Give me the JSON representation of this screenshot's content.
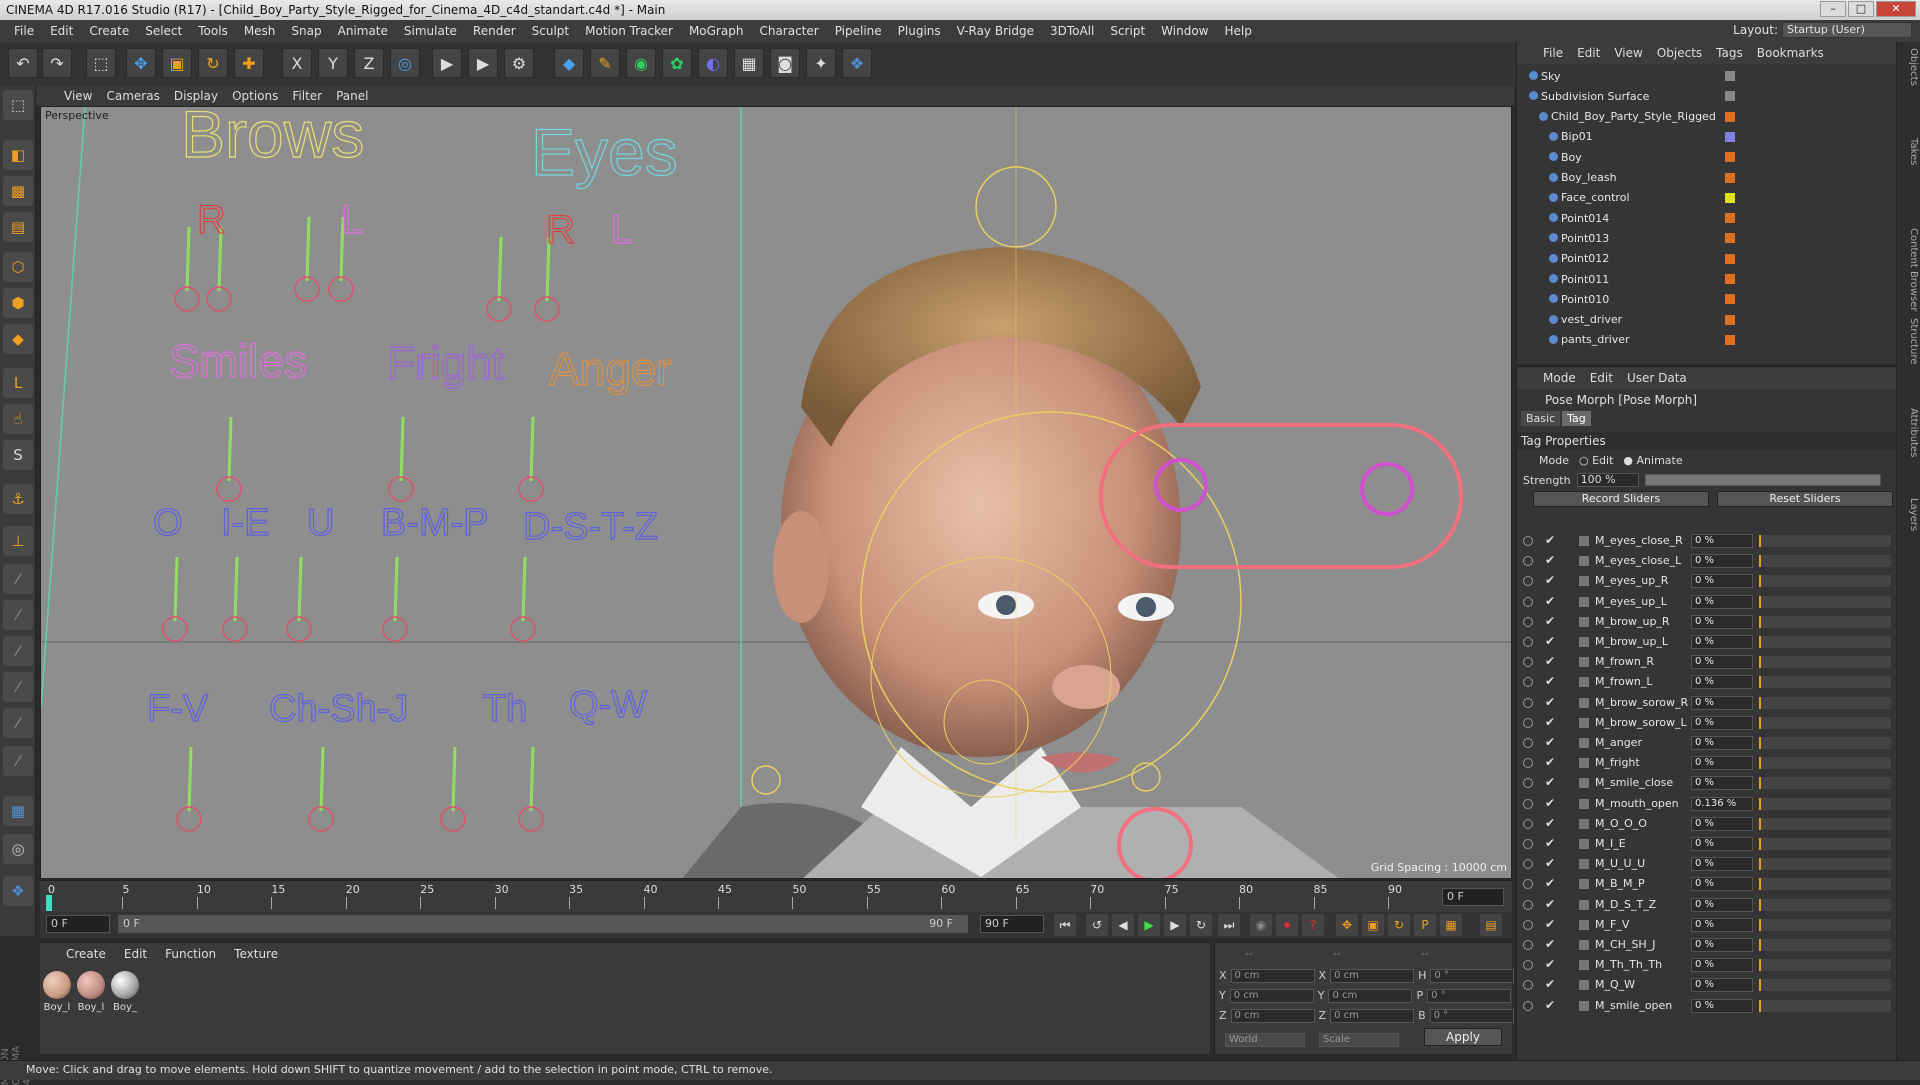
{
  "window": {
    "title": "CINEMA 4D R17.016 Studio (R17) - [Child_Boy_Party_Style_Rigged_for_Cinema_4D_c4d_standart.c4d *] - Main"
  },
  "menubar": [
    "File",
    "Edit",
    "Create",
    "Select",
    "Tools",
    "Mesh",
    "Snap",
    "Animate",
    "Simulate",
    "Render",
    "Sculpt",
    "Motion Tracker",
    "MoGraph",
    "Character",
    "Pipeline",
    "Plugins",
    "V-Ray Bridge",
    "3DToAll",
    "Script",
    "Window",
    "Help"
  ],
  "layout": {
    "label": "Layout:",
    "value": "Startup (User)"
  },
  "viewport": {
    "menu": [
      "View",
      "Cameras",
      "Display",
      "Options",
      "Filter",
      "Panel"
    ],
    "label": "Perspective",
    "grid_spacing": "Grid Spacing : 10000 cm",
    "face_labels": {
      "brows": "Brows",
      "eyes": "Eyes",
      "r1": "R",
      "l1": "L",
      "r2": "R",
      "l2": "L",
      "smiles": "Smiles",
      "fright": "Fright",
      "anger": "Anger",
      "o": "O",
      "ie": "I-E",
      "u": "U",
      "bmp": "B-M-P",
      "dstz": "D-S-T-Z",
      "fv": "F-V",
      "chshj": "Ch-Sh-J",
      "th": "Th",
      "qw": "Q-W"
    },
    "colors": {
      "brows": "#e8e070",
      "eyes": "#70d8e0",
      "r": "#e04040",
      "smiles": "#e070e0",
      "fright": "#a060e0",
      "anger": "#e09040",
      "phoneme": "#6060e0"
    }
  },
  "timeline": {
    "ticks": [
      "0",
      "5",
      "10",
      "15",
      "20",
      "25",
      "30",
      "35",
      "40",
      "45",
      "50",
      "55",
      "60",
      "65",
      "70",
      "75",
      "80",
      "85",
      "90"
    ],
    "current_frame": "0 F",
    "start": "0 F",
    "range_start": "0 F",
    "range_end": "90 F",
    "end": "90 F"
  },
  "materials": {
    "menu": [
      "Create",
      "Edit",
      "Function",
      "Texture"
    ],
    "items": [
      {
        "name": "Boy_l",
        "color": "#c89a80"
      },
      {
        "name": "Boy_l",
        "color": "#c08a80"
      },
      {
        "name": "Boy_",
        "color": "#a0a0a0"
      }
    ]
  },
  "coords": {
    "header": [
      "--",
      "--",
      "--"
    ],
    "rows": [
      {
        "a": "X",
        "av": "0 cm",
        "b": "X",
        "bv": "0 cm",
        "c": "H",
        "cv": "0 °"
      },
      {
        "a": "Y",
        "av": "0 cm",
        "b": "Y",
        "bv": "0 cm",
        "c": "P",
        "cv": "0 °"
      },
      {
        "a": "Z",
        "av": "0 cm",
        "b": "Z",
        "bv": "0 cm",
        "c": "B",
        "cv": "0 °"
      }
    ],
    "space": "World",
    "mode": "Scale",
    "apply": "Apply"
  },
  "status": "Move: Click and drag to move elements. Hold down SHIFT to quantize movement / add to the selection in point mode, CTRL to remove.",
  "object_manager": {
    "menu": [
      "File",
      "Edit",
      "View",
      "Objects",
      "Tags",
      "Bookmarks"
    ],
    "objects": [
      {
        "name": "Sky",
        "indent": 0,
        "color": "#888888"
      },
      {
        "name": "Subdivision Surface",
        "indent": 0,
        "color": "#888888"
      },
      {
        "name": "Child_Boy_Party_Style_Rigged",
        "indent": 1,
        "color": "#e07020"
      },
      {
        "name": "Bip01",
        "indent": 2,
        "color": "#8080e0"
      },
      {
        "name": "Boy",
        "indent": 2,
        "color": "#e07020"
      },
      {
        "name": "Boy_leash",
        "indent": 2,
        "color": "#e07020"
      },
      {
        "name": "Face_control",
        "indent": 2,
        "color": "#e0e020"
      },
      {
        "name": "Point014",
        "indent": 2,
        "color": "#e07020"
      },
      {
        "name": "Point013",
        "indent": 2,
        "color": "#e07020"
      },
      {
        "name": "Point012",
        "indent": 2,
        "color": "#e07020"
      },
      {
        "name": "Point011",
        "indent": 2,
        "color": "#e07020"
      },
      {
        "name": "Point010",
        "indent": 2,
        "color": "#e07020"
      },
      {
        "name": "vest_driver",
        "indent": 2,
        "color": "#e07020"
      },
      {
        "name": "pants_driver",
        "indent": 2,
        "color": "#e07020"
      }
    ]
  },
  "attributes": {
    "menu": [
      "Mode",
      "Edit",
      "User Data"
    ],
    "title": "Pose Morph [Pose Morph]",
    "tabs": [
      "Basic",
      "Tag"
    ],
    "section": "Tag Properties",
    "mode_label": "Mode",
    "mode_edit": "Edit",
    "mode_animate": "Animate",
    "strength_label": "Strength",
    "strength_value": "100 %",
    "record": "Record Sliders",
    "reset": "Reset Sliders",
    "sliders": [
      {
        "name": "M_eyes_close_R",
        "value": "0 %"
      },
      {
        "name": "M_eyes_close_L",
        "value": "0 %"
      },
      {
        "name": "M_eyes_up_R",
        "value": "0 %"
      },
      {
        "name": "M_eyes_up_L",
        "value": "0 %"
      },
      {
        "name": "M_brow_up_R",
        "value": "0 %"
      },
      {
        "name": "M_brow_up_L",
        "value": "0 %"
      },
      {
        "name": "M_frown_R",
        "value": "0 %"
      },
      {
        "name": "M_frown_L",
        "value": "0 %"
      },
      {
        "name": "M_brow_sorow_R",
        "value": "0 %"
      },
      {
        "name": "M_brow_sorow_L",
        "value": "0 %"
      },
      {
        "name": "M_anger",
        "value": "0 %"
      },
      {
        "name": "M_fright",
        "value": "0 %"
      },
      {
        "name": "M_smile_close",
        "value": "0 %"
      },
      {
        "name": "M_mouth_open",
        "value": "0.136 %"
      },
      {
        "name": "M_O_O_O",
        "value": "0 %"
      },
      {
        "name": "M_I_E",
        "value": "0 %"
      },
      {
        "name": "M_U_U_U",
        "value": "0 %"
      },
      {
        "name": "M_B_M_P",
        "value": "0 %"
      },
      {
        "name": "M_D_S_T_Z",
        "value": "0 %"
      },
      {
        "name": "M_F_V",
        "value": "0 %"
      },
      {
        "name": "M_CH_SH_J",
        "value": "0 %"
      },
      {
        "name": "M_Th_Th_Th",
        "value": "0 %"
      },
      {
        "name": "M_Q_W",
        "value": "0 %"
      },
      {
        "name": "M_smile_open",
        "value": "0 %"
      }
    ]
  },
  "right_tabs": [
    "Objects",
    "Takes",
    "Content Browser",
    "Structure",
    "Attributes",
    "Layers"
  ]
}
